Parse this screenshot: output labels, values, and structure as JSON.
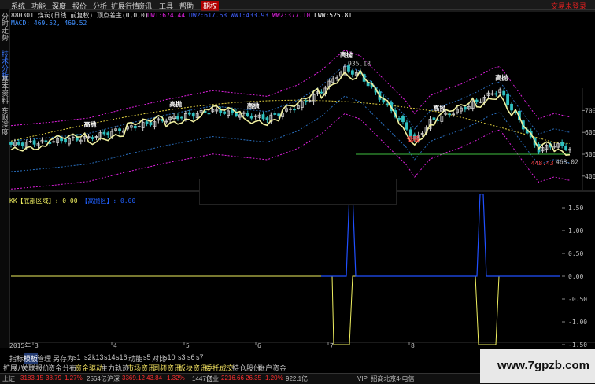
{
  "menubar": {
    "items": [
      "系统",
      "功能",
      "深度",
      "报价",
      "分析",
      "扩展行情",
      "资讯",
      "工具",
      "帮助"
    ],
    "active_item": "期权",
    "login_text": "交易未登录"
  },
  "sidetabs": [
    {
      "label": "分时走势",
      "active": false
    },
    {
      "label": "技术分析",
      "active": true
    },
    {
      "label": "基本资料",
      "active": false
    },
    {
      "label": "东财深度",
      "active": false
    }
  ],
  "price_panel": {
    "header": "880301 煤炭(日线 前复权) 顶点差主(0,0,0)",
    "ma_values": [
      {
        "label": "UW1:",
        "value": "674.44",
        "color": "#e020e0"
      },
      {
        "label": "UW2:",
        "value": "617.68",
        "color": "#4060ff"
      },
      {
        "label": "WW1:",
        "value": "433.93",
        "color": "#4060ff"
      },
      {
        "label": "WW2:",
        "value": "377.10",
        "color": "#e020e0"
      },
      {
        "label": "LWW:",
        "value": "525.81",
        "color": "#ffffff"
      }
    ],
    "macd_label": "MACD:",
    "macd_values": [
      "469.52",
      "469.52"
    ],
    "y_ticks": [
      "700.00",
      "600.00",
      "500.00",
      "400.00"
    ],
    "price_label_high": "935.18",
    "price_label_current": "468.02",
    "price_label_low": "448.43",
    "signal_buy": "高抛",
    "signal_buy_low": "低吸",
    "signal_sell": "低吸"
  },
  "indicator_panel": {
    "title": "KK【底部区域】: 0.00",
    "title2": "【高抛区】: 0.00",
    "y_ticks": [
      "1.50",
      "1.00",
      "0.50",
      "0.00",
      "-0.50",
      "-1.00",
      "-1.50"
    ]
  },
  "x_axis": {
    "year": "2015年",
    "labels": [
      "3",
      "4",
      "5",
      "6",
      "7",
      "8"
    ]
  },
  "bottom_tabs": [
    "指标",
    "模板",
    "管理",
    "另存为",
    "s1",
    "s2",
    "k13",
    "s14",
    "s16",
    "动能",
    "s5",
    "对比",
    "s10",
    "s3",
    "s6",
    "s7"
  ],
  "bottom_tabs_active": "模板",
  "func_bar": [
    {
      "label": "扩展八",
      "hl": false
    },
    {
      "label": "关联报价",
      "hl": false
    },
    {
      "label": "资金分布",
      "hl": false
    },
    {
      "label": "资金驱动",
      "hl": true
    },
    {
      "label": "主力轨迹",
      "hl": false
    },
    {
      "label": "市场资讯",
      "hl": true
    },
    {
      "label": "同频资讯",
      "hl": true
    },
    {
      "label": "板块资讯",
      "hl": true
    },
    {
      "label": "委托成交",
      "hl": true
    },
    {
      "label": "持仓股份",
      "hl": false
    },
    {
      "label": "帐户资金",
      "hl": false
    }
  ],
  "status_bar": [
    {
      "label": "上证",
      "color": "#c0c0c0"
    },
    {
      "label": "3183.15",
      "color": "#ff3030"
    },
    {
      "label": "38.79",
      "color": "#ff3030"
    },
    {
      "label": "1.27%",
      "color": "#ff3030"
    },
    {
      "label": "2564亿",
      "color": "#c0c0c0"
    },
    {
      "label": "沪深",
      "color": "#c0c0c0"
    },
    {
      "label": "3369.12",
      "color": "#ff3030"
    },
    {
      "label": "43.84",
      "color": "#ff3030"
    },
    {
      "label": "1.32%",
      "color": "#ff3030"
    },
    {
      "label": "1447亿",
      "color": "#c0c0c0"
    },
    {
      "label": "创业",
      "color": "#c0c0c0"
    },
    {
      "label": "2216.66",
      "color": "#ff3030"
    },
    {
      "label": "26.35",
      "color": "#ff3030"
    },
    {
      "label": "1.20%",
      "color": "#ff3030"
    },
    {
      "label": "922.1亿",
      "color": "#c0c0c0"
    },
    {
      "label": "VIP_招商北京4-电信",
      "color": "#c0c0c0"
    }
  ],
  "watermark": "www.7gpzb.com",
  "colors": {
    "up": "#ff3030",
    "down": "#30c0c0",
    "yellow": "#f0f060",
    "blue": "#2060ff",
    "magenta": "#e020e0"
  },
  "chart_data": [
    {
      "type": "line",
      "title": "880301 煤炭(日线 前复权)",
      "x": [
        "3",
        "4",
        "5",
        "6",
        "7",
        "8"
      ],
      "ylim": [
        350,
        1000
      ],
      "series": [
        {
          "name": "LWW",
          "values": [
            545,
            600,
            665,
            735,
            890,
            680,
            725,
            780,
            640,
            525
          ]
        }
      ]
    },
    {
      "type": "line",
      "title": "KK【底部区域】",
      "ylim": [
        -1.8,
        2.0
      ],
      "series": [
        {
          "name": "KK",
          "values": [
            0,
            0,
            0,
            0,
            0,
            -1.5,
            -1.5,
            0,
            0,
            -1.5,
            -1.5,
            0
          ]
        },
        {
          "name": "高抛区",
          "values": [
            0,
            0,
            0,
            0,
            0,
            0,
            1.75,
            0,
            0,
            1.75,
            0,
            0
          ]
        }
      ]
    }
  ]
}
